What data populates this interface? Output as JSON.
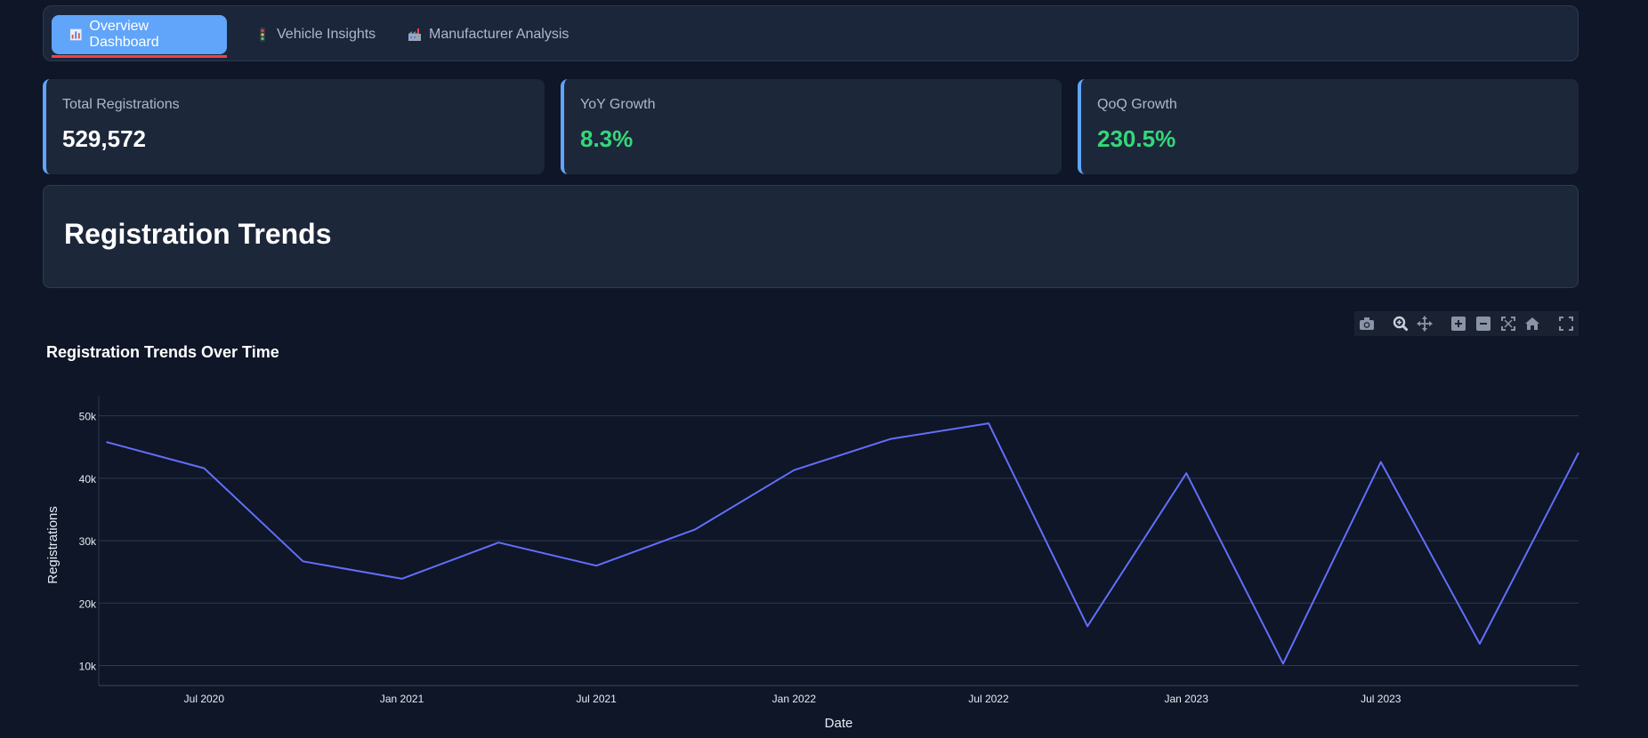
{
  "tabs": [
    {
      "label": "Overview Dashboard",
      "icon": "bar-chart-icon",
      "active": true
    },
    {
      "label": "Vehicle Insights",
      "icon": "traffic-light-icon",
      "active": false
    },
    {
      "label": "Manufacturer Analysis",
      "icon": "factory-icon",
      "active": false
    }
  ],
  "metrics": [
    {
      "label": "Total Registrations",
      "value": "529,572",
      "color": "#ffffff"
    },
    {
      "label": "YoY Growth",
      "value": "8.3%",
      "color": "#34d879"
    },
    {
      "label": "QoQ Growth",
      "value": "230.5%",
      "color": "#34d879"
    }
  ],
  "section": {
    "title": "Registration Trends"
  },
  "modebar": [
    "camera-icon",
    "zoom-icon",
    "pan-icon",
    "zoom-in-icon",
    "zoom-out-icon",
    "autoscale-icon",
    "reset-axes-icon",
    "fullscreen-icon"
  ],
  "chart_data": {
    "type": "line",
    "title": "Registration Trends Over Time",
    "xlabel": "Date",
    "ylabel": "Registrations",
    "line_color": "#636efa",
    "x": [
      "2020-04-01",
      "2020-07-01",
      "2020-10-01",
      "2021-01-01",
      "2021-04-01",
      "2021-07-01",
      "2021-10-01",
      "2022-01-01",
      "2022-04-01",
      "2022-07-01",
      "2022-10-01",
      "2023-01-01",
      "2023-04-01",
      "2023-07-01",
      "2023-10-01",
      "2024-01-01"
    ],
    "series": [
      {
        "values": [
          45800,
          41600,
          26700,
          23900,
          29700,
          26000,
          31800,
          41300,
          46300,
          48800,
          16300,
          40800,
          10300,
          42600,
          13500,
          44100
        ]
      }
    ],
    "xticks": [
      {
        "date": "2020-07-01",
        "label": "Jul 2020"
      },
      {
        "date": "2021-01-01",
        "label": "Jan 2021"
      },
      {
        "date": "2021-07-01",
        "label": "Jul 2021"
      },
      {
        "date": "2022-01-01",
        "label": "Jan 2022"
      },
      {
        "date": "2022-07-01",
        "label": "Jul 2022"
      },
      {
        "date": "2023-01-01",
        "label": "Jan 2023"
      },
      {
        "date": "2023-07-01",
        "label": "Jul 2023"
      }
    ],
    "yticks": [
      {
        "value": 10000,
        "label": "10k"
      },
      {
        "value": 20000,
        "label": "20k"
      },
      {
        "value": 30000,
        "label": "30k"
      },
      {
        "value": 40000,
        "label": "40k"
      },
      {
        "value": 50000,
        "label": "50k"
      }
    ],
    "xlim": [
      "2020-03-25",
      "2024-01-01"
    ],
    "ylim": [
      6800,
      51800
    ],
    "grid": true
  }
}
